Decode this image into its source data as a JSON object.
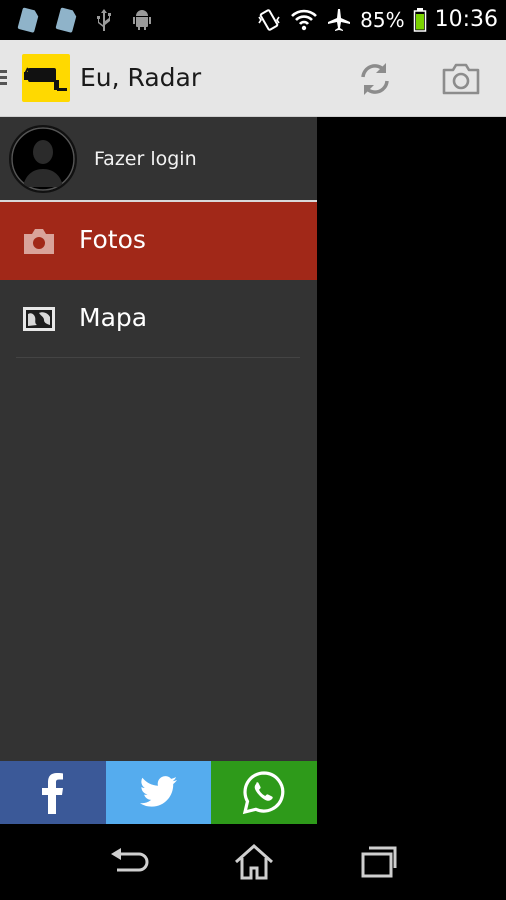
{
  "status_bar": {
    "battery": "85%",
    "time": "10:36",
    "left_icons": [
      "sim-card-icon",
      "sim-card-icon",
      "usb-icon",
      "android-icon"
    ],
    "right_icons": [
      "vibrate-icon",
      "wifi-icon",
      "airplane-icon",
      "battery-icon"
    ]
  },
  "action_bar": {
    "title": "Eu, Radar",
    "logo": "radar-camera-logo",
    "actions": [
      "refresh-icon",
      "camera-icon"
    ]
  },
  "drawer": {
    "login_label": "Fazer login",
    "items": [
      {
        "label": "Fotos",
        "icon": "camera-icon",
        "active": true
      },
      {
        "label": "Mapa",
        "icon": "map-icon",
        "active": false
      }
    ]
  },
  "share_bar": {
    "buttons": [
      {
        "network": "facebook",
        "color": "#3b5998"
      },
      {
        "network": "twitter",
        "color": "#55acee"
      },
      {
        "network": "whatsapp",
        "color": "#2e9a1a"
      }
    ]
  },
  "colors": {
    "accent_active": "#a12818",
    "drawer_bg": "#333333",
    "actionbar_bg": "#e6e6e6",
    "logo_yellow": "#ffd900"
  }
}
